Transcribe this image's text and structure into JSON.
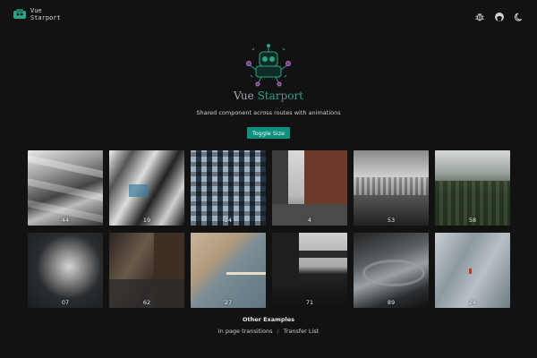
{
  "header": {
    "logo_text": "Vue\nStarport",
    "icons": [
      "bug-icon",
      "github-icon",
      "moon-icon"
    ]
  },
  "hero": {
    "title_a": "Vue",
    "title_b": "Starport",
    "subtitle": "Shared component across routes with animations"
  },
  "toggle_label": "Toggle Size",
  "cards": [
    {
      "label": "44"
    },
    {
      "label": "19"
    },
    {
      "label": "24"
    },
    {
      "label": "4"
    },
    {
      "label": "53"
    },
    {
      "label": "58"
    },
    {
      "label": "07"
    },
    {
      "label": "62"
    },
    {
      "label": "27"
    },
    {
      "label": "71"
    },
    {
      "label": "89"
    },
    {
      "label": "24"
    }
  ],
  "footer": {
    "title": "Other Examples",
    "link1": "In page transitions",
    "separator": "/",
    "link2": "Transfer List"
  },
  "colors": {
    "accent": "#0f8f7f",
    "brand_green": "#2aa38a",
    "background": "#121212"
  }
}
